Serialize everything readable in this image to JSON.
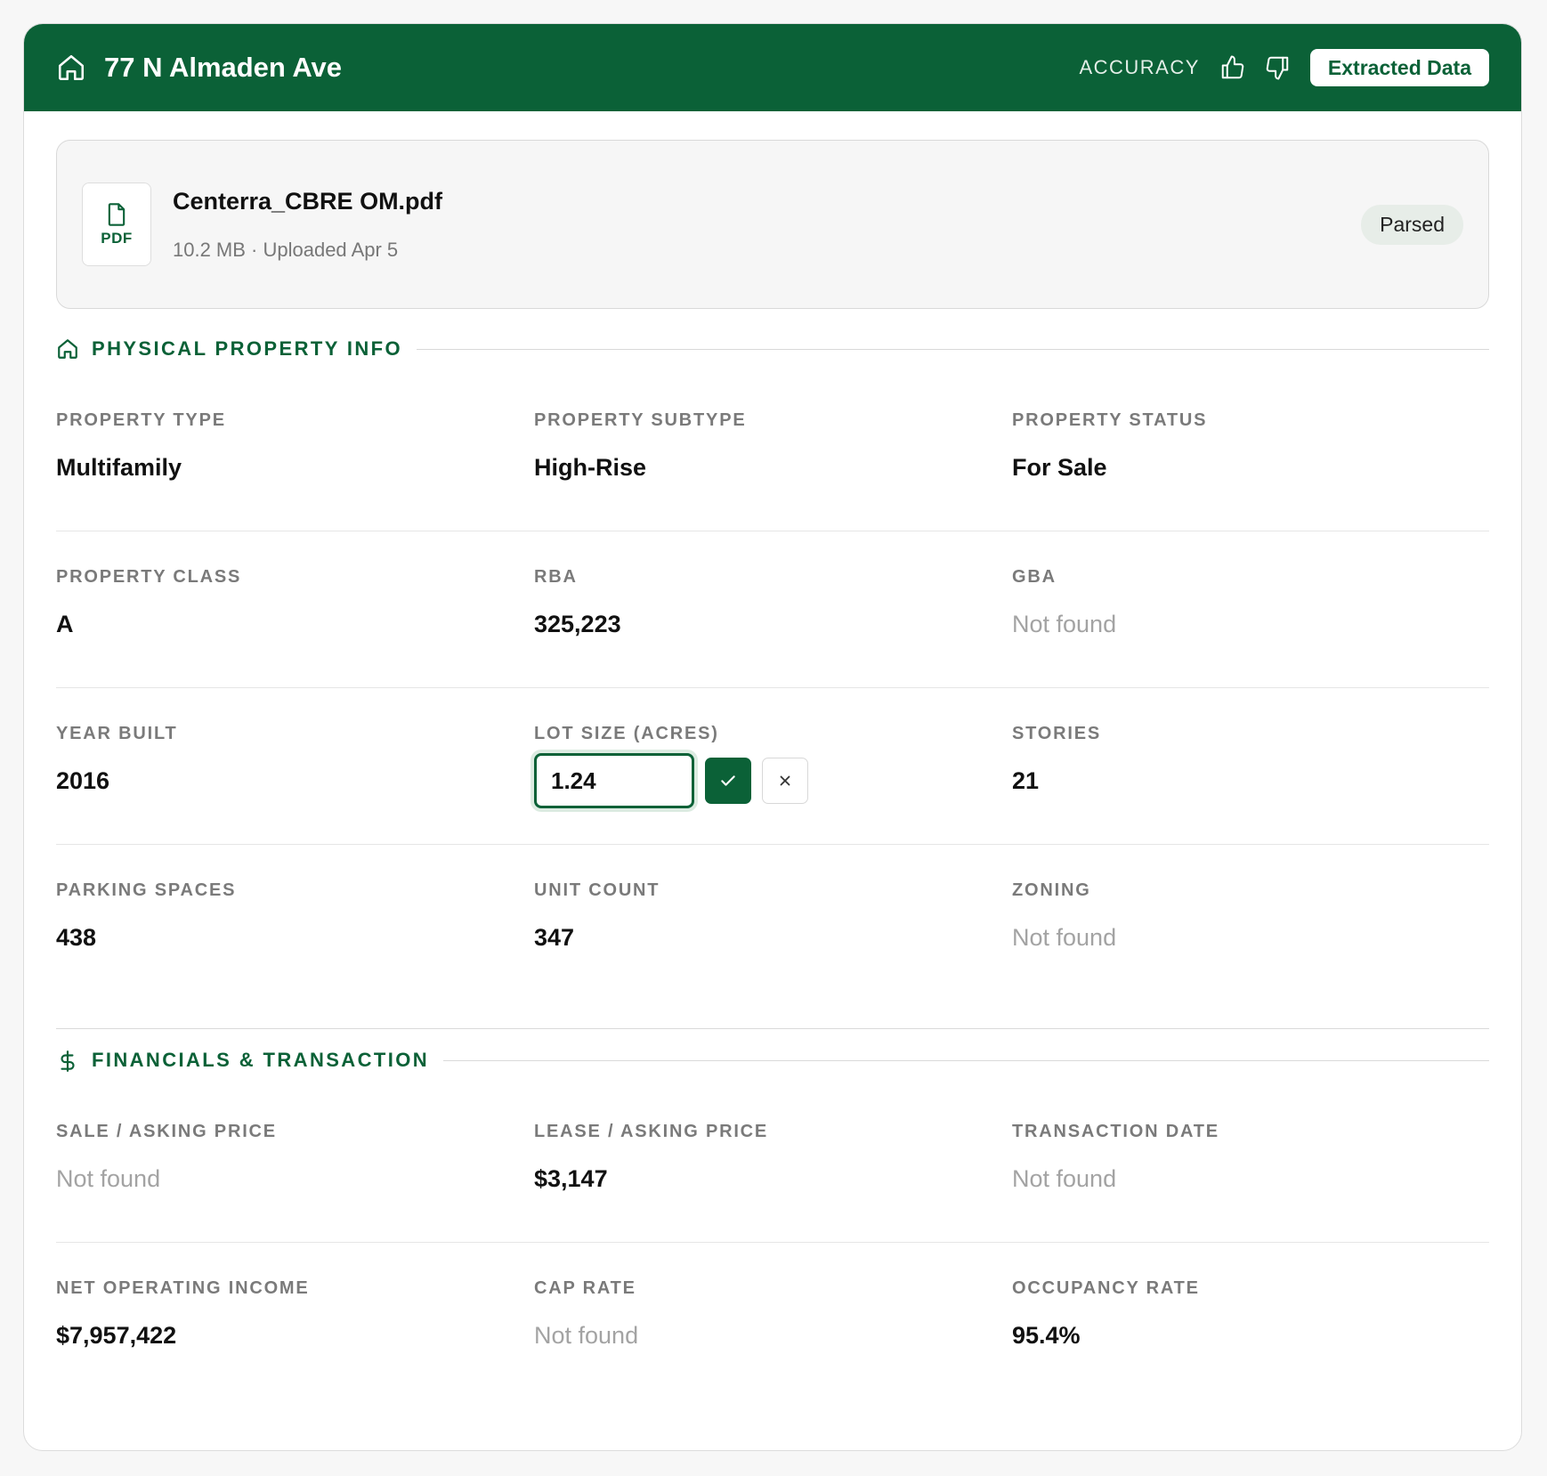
{
  "header": {
    "title": "77 N Almaden Ave",
    "accuracy_label": "ACCURACY",
    "extracted_button": "Extracted Data",
    "brand_color": "#0b6137"
  },
  "file": {
    "icon_label": "PDF",
    "name": "Centerra_CBRE OM.pdf",
    "meta": "10.2 MB · Uploaded Apr 5",
    "status": "Parsed"
  },
  "physical": {
    "title": "PHYSICAL PROPERTY INFO",
    "rows": [
      [
        {
          "label": "PROPERTY TYPE",
          "value": "Multifamily"
        },
        {
          "label": "PROPERTY SUBTYPE",
          "value": "High-Rise"
        },
        {
          "label": "PROPERTY STATUS",
          "value": "For Sale"
        }
      ],
      [
        {
          "label": "PROPERTY CLASS",
          "value": "A"
        },
        {
          "label": "RBA",
          "value": "325,223"
        },
        {
          "label": "GBA",
          "value": "Not found"
        }
      ],
      [
        {
          "label": "YEAR BUILT",
          "value": "2016"
        },
        {
          "label": "LOT SIZE (ACRES)",
          "value": "1.24"
        },
        {
          "label": "STORIES",
          "value": "21"
        }
      ],
      [
        {
          "label": "PARKING SPACES",
          "value": "438"
        },
        {
          "label": "UNIT COUNT",
          "value": "347"
        },
        {
          "label": "ZONING",
          "value": "Not found"
        }
      ]
    ]
  },
  "financial": {
    "title": "FINANCIALS & TRANSACTION",
    "rows": [
      [
        {
          "label": "SALE / ASKING PRICE",
          "value": "Not found"
        },
        {
          "label": "LEASE / ASKING PRICE",
          "value": "$3,147"
        },
        {
          "label": "TRANSACTION DATE",
          "value": "Not found"
        }
      ],
      [
        {
          "label": "NET OPERATING INCOME",
          "value": "$7,957,422"
        },
        {
          "label": "CAP RATE",
          "value": "Not found"
        },
        {
          "label": "OCCUPANCY RATE",
          "value": "95.4%"
        }
      ]
    ]
  }
}
